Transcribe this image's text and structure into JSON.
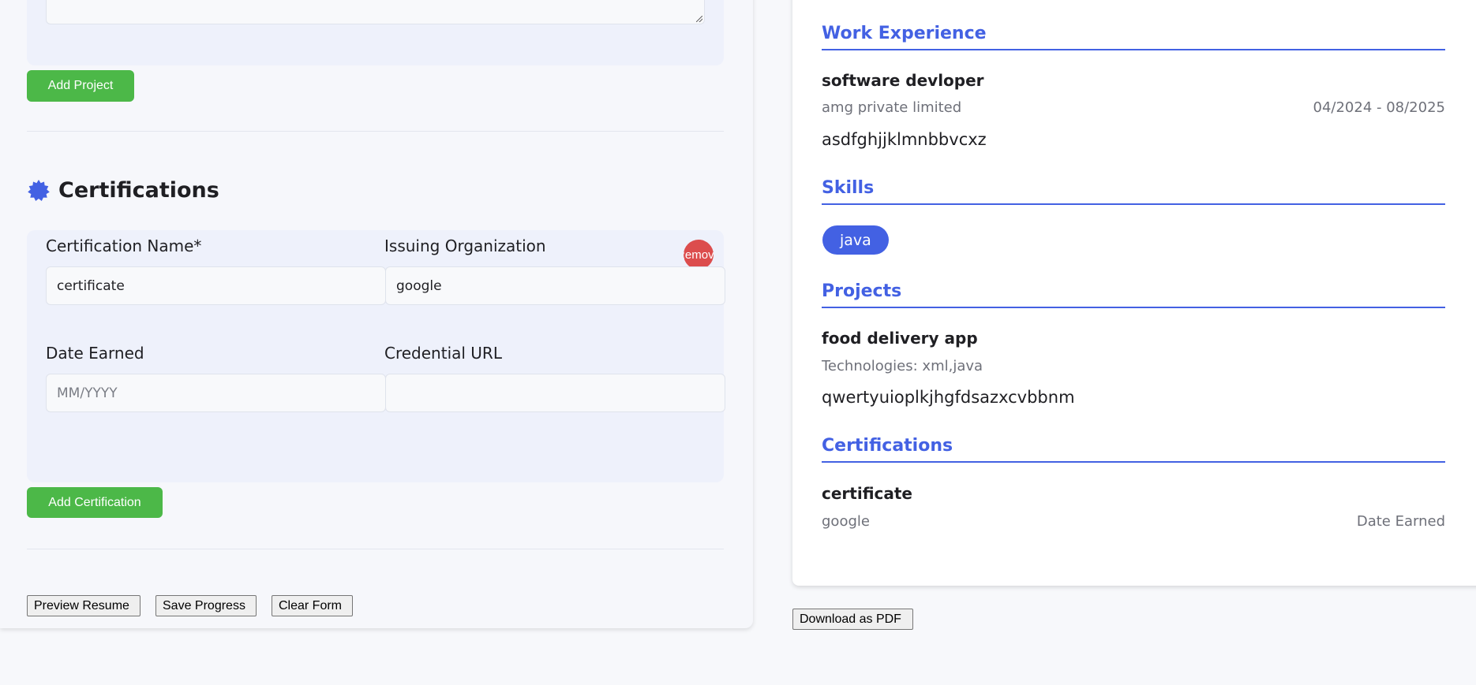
{
  "form": {
    "add_project_label": "Add Project",
    "certifications_title": "Certifications",
    "certification": {
      "name_label": "Certification Name*",
      "name_value": "certificate",
      "org_label": "Issuing Organization",
      "org_value": "google",
      "date_label": "Date Earned",
      "date_placeholder": "MM/YYYY",
      "url_label": "Credential URL",
      "url_value": "",
      "remove_label": "Remove"
    },
    "add_certification_label": "Add Certification",
    "actions": {
      "preview": "Preview Resume",
      "save": "Save Progress",
      "clear": "Clear Form"
    }
  },
  "preview": {
    "work_heading": "Work Experience",
    "work": {
      "title": "software devloper",
      "company": "amg private limited",
      "dates": "04/2024 - 08/2025",
      "description": "asdfghjjklmnbbvcxz"
    },
    "skills_heading": "Skills",
    "skills": [
      "java"
    ],
    "projects_heading": "Projects",
    "project": {
      "title": "food delivery app",
      "technologies": "Technologies: xml,java",
      "description": "qwertyuioplkjhgfdsazxcvbbnm"
    },
    "certifications_heading": "Certifications",
    "certification": {
      "name": "certificate",
      "org": "google",
      "date": "Date Earned"
    },
    "download_label": "Download as PDF"
  },
  "colors": {
    "accent": "#4361e3",
    "add_button": "#4cb848",
    "remove_button": "#dc4d4d"
  },
  "icons": {
    "certifications_section": "certificate-badge-icon",
    "textarea_resize": "resize-handle-icon"
  }
}
